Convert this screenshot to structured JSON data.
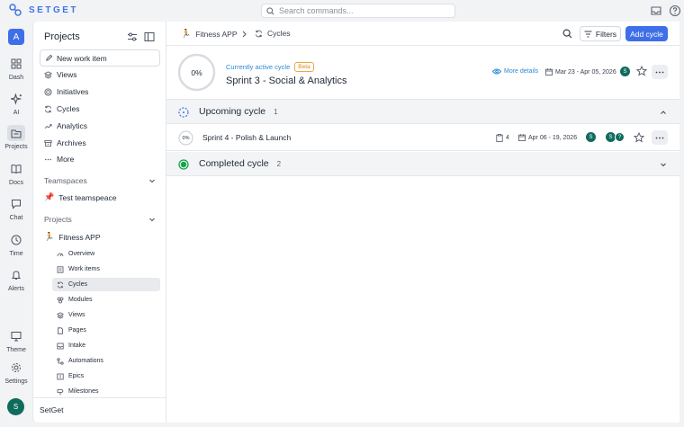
{
  "app": {
    "logo_text": "SETGET"
  },
  "search": {
    "placeholder": "Search commands..."
  },
  "rail": {
    "workspace_initial": "A",
    "items": [
      {
        "label": "Dash",
        "icon": "dashboard-icon"
      },
      {
        "label": "AI",
        "icon": "sparkle-icon"
      },
      {
        "label": "Projects",
        "icon": "folder-icon"
      },
      {
        "label": "Docs",
        "icon": "book-icon"
      },
      {
        "label": "Chat",
        "icon": "chat-icon"
      },
      {
        "label": "Time",
        "icon": "clock-icon"
      },
      {
        "label": "Alerts",
        "icon": "bell-icon"
      },
      {
        "label": "Theme",
        "icon": "monitor-icon"
      },
      {
        "label": "Settings",
        "icon": "gear-icon"
      }
    ],
    "user_initial": "S"
  },
  "sidebar": {
    "title": "Projects",
    "new_item": "New work item",
    "nav": [
      "Views",
      "Initiatives",
      "Cycles",
      "Analytics",
      "Archives",
      "More"
    ],
    "teamspaces_label": "Teamspaces",
    "teamspace": "Test teamspeace",
    "projects_label": "Projects",
    "project": "Fitness APP",
    "project_sub": [
      "Overview",
      "Work items",
      "Cycles",
      "Modules",
      "Views",
      "Pages",
      "Intake",
      "Automations",
      "Epics",
      "Milestones"
    ],
    "footer": "SetGet"
  },
  "header": {
    "breadcrumb_project": "Fitness APP",
    "breadcrumb_page": "Cycles",
    "filters_label": "Filters",
    "add_label": "Add cycle"
  },
  "active_cycle": {
    "progress": "0%",
    "label": "Currently active cycle",
    "badge": "Beta",
    "name": "Sprint 3 - Social & Analytics",
    "more_details": "More details",
    "dates": "Mar 23 - Apr 05, 2026",
    "assignee": "S"
  },
  "upcoming": {
    "title": "Upcoming cycle",
    "count": "1",
    "cycle": {
      "progress": "0%",
      "name": "Sprint 4 - Polish & Launch",
      "issues": "4",
      "dates": "Apr 06 - 19, 2026",
      "assignee": "S",
      "members": [
        "S",
        "?"
      ]
    }
  },
  "completed": {
    "title": "Completed cycle",
    "count": "2"
  },
  "colors": {
    "accent": "#3f6fe8",
    "link": "#2a8ad4",
    "avatar": "#0f6b5c",
    "beta": "#e08a1e",
    "complete": "#16a34a"
  }
}
